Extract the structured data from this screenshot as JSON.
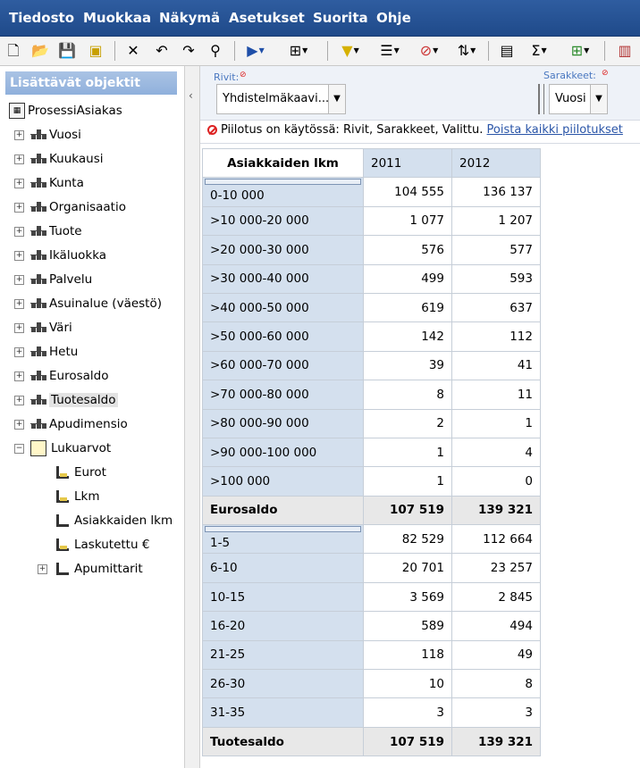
{
  "menubar": {
    "items": [
      "Tiedosto",
      "Muokkaa",
      "Näkymä",
      "Asetukset",
      "Suorita",
      "Ohje"
    ]
  },
  "toolbar": {
    "icons": [
      "new-file-icon",
      "open-folder-icon",
      "save-icon",
      "save-all-icon",
      "delete-icon",
      "undo-icon",
      "redo-icon",
      "search-icon",
      "run-icon",
      "export-icon",
      "filter-icon",
      "sort-icon",
      "hide-icon",
      "sort-az-icon",
      "edit-icon",
      "sum-icon",
      "grid-icon",
      "chart-icon"
    ]
  },
  "left_panel": {
    "title": "Lisättävät objektit",
    "root": "ProsessiAsiakas",
    "dimensions": [
      "Vuosi",
      "Kuukausi",
      "Kunta",
      "Organisaatio",
      "Tuote",
      "Ikäluokka",
      "Palvelu",
      "Asuinalue (väestö)",
      "Väri",
      "Hetu",
      "Eurosaldo",
      "Tuotesaldo",
      "Apudimensio"
    ],
    "measures_folder": "Lukuarvot",
    "measures": [
      "Eurot",
      "Lkm",
      "Asiakkaiden lkm",
      "Laskutettu €",
      "Apumittarit"
    ]
  },
  "pivot": {
    "rows_label": "Rivit:",
    "rows_value": "Yhdistelmäkaavi...",
    "cols_label": "Sarakkeet:",
    "cols_value": "Vuosi"
  },
  "filter_notice": {
    "text": "Piilotus on käytössä: Rivit, Sarakkeet, Valittu.",
    "link": "Poista kaikki piilotukset"
  },
  "grid": {
    "measure": "Asiakkaiden lkm",
    "columns": [
      "2011",
      "2012"
    ],
    "groups": [
      {
        "name": "Eurosaldo",
        "rows": [
          {
            "label": "0-10 000",
            "v": [
              "104 555",
              "136 137"
            ]
          },
          {
            "label": ">10 000-20 000",
            "v": [
              "1 077",
              "1 207"
            ]
          },
          {
            "label": ">20 000-30 000",
            "v": [
              "576",
              "577"
            ]
          },
          {
            "label": ">30 000-40 000",
            "v": [
              "499",
              "593"
            ]
          },
          {
            "label": ">40 000-50 000",
            "v": [
              "619",
              "637"
            ]
          },
          {
            "label": ">50 000-60 000",
            "v": [
              "142",
              "112"
            ]
          },
          {
            "label": ">60 000-70 000",
            "v": [
              "39",
              "41"
            ]
          },
          {
            "label": ">70 000-80 000",
            "v": [
              "8",
              "11"
            ]
          },
          {
            "label": ">80 000-90 000",
            "v": [
              "2",
              "1"
            ]
          },
          {
            "label": ">90 000-100 000",
            "v": [
              "1",
              "4"
            ]
          },
          {
            "label": ">100 000",
            "v": [
              "1",
              "0"
            ]
          }
        ],
        "total": [
          "107 519",
          "139 321"
        ]
      },
      {
        "name": "Tuotesaldo",
        "rows": [
          {
            "label": "1-5",
            "v": [
              "82 529",
              "112 664"
            ]
          },
          {
            "label": "6-10",
            "v": [
              "20 701",
              "23 257"
            ]
          },
          {
            "label": "10-15",
            "v": [
              "3 569",
              "2 845"
            ]
          },
          {
            "label": "16-20",
            "v": [
              "589",
              "494"
            ]
          },
          {
            "label": "21-25",
            "v": [
              "118",
              "49"
            ]
          },
          {
            "label": "26-30",
            "v": [
              "10",
              "8"
            ]
          },
          {
            "label": "31-35",
            "v": [
              "3",
              "3"
            ]
          }
        ],
        "total": [
          "107 519",
          "139 321"
        ]
      }
    ]
  }
}
